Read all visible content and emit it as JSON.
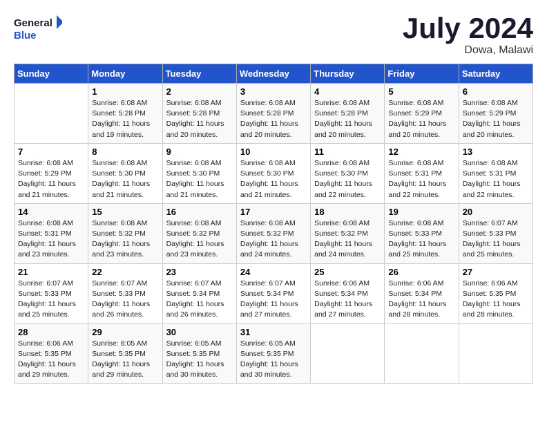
{
  "header": {
    "logo_line1": "General",
    "logo_line2": "Blue",
    "month_year": "July 2024",
    "location": "Dowa, Malawi"
  },
  "days_of_week": [
    "Sunday",
    "Monday",
    "Tuesday",
    "Wednesday",
    "Thursday",
    "Friday",
    "Saturday"
  ],
  "weeks": [
    [
      {
        "day": "",
        "sunrise": "",
        "sunset": "",
        "daylight": ""
      },
      {
        "day": "1",
        "sunrise": "Sunrise: 6:08 AM",
        "sunset": "Sunset: 5:28 PM",
        "daylight": "Daylight: 11 hours and 19 minutes."
      },
      {
        "day": "2",
        "sunrise": "Sunrise: 6:08 AM",
        "sunset": "Sunset: 5:28 PM",
        "daylight": "Daylight: 11 hours and 20 minutes."
      },
      {
        "day": "3",
        "sunrise": "Sunrise: 6:08 AM",
        "sunset": "Sunset: 5:28 PM",
        "daylight": "Daylight: 11 hours and 20 minutes."
      },
      {
        "day": "4",
        "sunrise": "Sunrise: 6:08 AM",
        "sunset": "Sunset: 5:28 PM",
        "daylight": "Daylight: 11 hours and 20 minutes."
      },
      {
        "day": "5",
        "sunrise": "Sunrise: 6:08 AM",
        "sunset": "Sunset: 5:29 PM",
        "daylight": "Daylight: 11 hours and 20 minutes."
      },
      {
        "day": "6",
        "sunrise": "Sunrise: 6:08 AM",
        "sunset": "Sunset: 5:29 PM",
        "daylight": "Daylight: 11 hours and 20 minutes."
      }
    ],
    [
      {
        "day": "7",
        "sunrise": "Sunrise: 6:08 AM",
        "sunset": "Sunset: 5:29 PM",
        "daylight": "Daylight: 11 hours and 21 minutes."
      },
      {
        "day": "8",
        "sunrise": "Sunrise: 6:08 AM",
        "sunset": "Sunset: 5:30 PM",
        "daylight": "Daylight: 11 hours and 21 minutes."
      },
      {
        "day": "9",
        "sunrise": "Sunrise: 6:08 AM",
        "sunset": "Sunset: 5:30 PM",
        "daylight": "Daylight: 11 hours and 21 minutes."
      },
      {
        "day": "10",
        "sunrise": "Sunrise: 6:08 AM",
        "sunset": "Sunset: 5:30 PM",
        "daylight": "Daylight: 11 hours and 21 minutes."
      },
      {
        "day": "11",
        "sunrise": "Sunrise: 6:08 AM",
        "sunset": "Sunset: 5:30 PM",
        "daylight": "Daylight: 11 hours and 22 minutes."
      },
      {
        "day": "12",
        "sunrise": "Sunrise: 6:08 AM",
        "sunset": "Sunset: 5:31 PM",
        "daylight": "Daylight: 11 hours and 22 minutes."
      },
      {
        "day": "13",
        "sunrise": "Sunrise: 6:08 AM",
        "sunset": "Sunset: 5:31 PM",
        "daylight": "Daylight: 11 hours and 22 minutes."
      }
    ],
    [
      {
        "day": "14",
        "sunrise": "Sunrise: 6:08 AM",
        "sunset": "Sunset: 5:31 PM",
        "daylight": "Daylight: 11 hours and 23 minutes."
      },
      {
        "day": "15",
        "sunrise": "Sunrise: 6:08 AM",
        "sunset": "Sunset: 5:32 PM",
        "daylight": "Daylight: 11 hours and 23 minutes."
      },
      {
        "day": "16",
        "sunrise": "Sunrise: 6:08 AM",
        "sunset": "Sunset: 5:32 PM",
        "daylight": "Daylight: 11 hours and 23 minutes."
      },
      {
        "day": "17",
        "sunrise": "Sunrise: 6:08 AM",
        "sunset": "Sunset: 5:32 PM",
        "daylight": "Daylight: 11 hours and 24 minutes."
      },
      {
        "day": "18",
        "sunrise": "Sunrise: 6:08 AM",
        "sunset": "Sunset: 5:32 PM",
        "daylight": "Daylight: 11 hours and 24 minutes."
      },
      {
        "day": "19",
        "sunrise": "Sunrise: 6:08 AM",
        "sunset": "Sunset: 5:33 PM",
        "daylight": "Daylight: 11 hours and 25 minutes."
      },
      {
        "day": "20",
        "sunrise": "Sunrise: 6:07 AM",
        "sunset": "Sunset: 5:33 PM",
        "daylight": "Daylight: 11 hours and 25 minutes."
      }
    ],
    [
      {
        "day": "21",
        "sunrise": "Sunrise: 6:07 AM",
        "sunset": "Sunset: 5:33 PM",
        "daylight": "Daylight: 11 hours and 25 minutes."
      },
      {
        "day": "22",
        "sunrise": "Sunrise: 6:07 AM",
        "sunset": "Sunset: 5:33 PM",
        "daylight": "Daylight: 11 hours and 26 minutes."
      },
      {
        "day": "23",
        "sunrise": "Sunrise: 6:07 AM",
        "sunset": "Sunset: 5:34 PM",
        "daylight": "Daylight: 11 hours and 26 minutes."
      },
      {
        "day": "24",
        "sunrise": "Sunrise: 6:07 AM",
        "sunset": "Sunset: 5:34 PM",
        "daylight": "Daylight: 11 hours and 27 minutes."
      },
      {
        "day": "25",
        "sunrise": "Sunrise: 6:06 AM",
        "sunset": "Sunset: 5:34 PM",
        "daylight": "Daylight: 11 hours and 27 minutes."
      },
      {
        "day": "26",
        "sunrise": "Sunrise: 6:06 AM",
        "sunset": "Sunset: 5:34 PM",
        "daylight": "Daylight: 11 hours and 28 minutes."
      },
      {
        "day": "27",
        "sunrise": "Sunrise: 6:06 AM",
        "sunset": "Sunset: 5:35 PM",
        "daylight": "Daylight: 11 hours and 28 minutes."
      }
    ],
    [
      {
        "day": "28",
        "sunrise": "Sunrise: 6:06 AM",
        "sunset": "Sunset: 5:35 PM",
        "daylight": "Daylight: 11 hours and 29 minutes."
      },
      {
        "day": "29",
        "sunrise": "Sunrise: 6:05 AM",
        "sunset": "Sunset: 5:35 PM",
        "daylight": "Daylight: 11 hours and 29 minutes."
      },
      {
        "day": "30",
        "sunrise": "Sunrise: 6:05 AM",
        "sunset": "Sunset: 5:35 PM",
        "daylight": "Daylight: 11 hours and 30 minutes."
      },
      {
        "day": "31",
        "sunrise": "Sunrise: 6:05 AM",
        "sunset": "Sunset: 5:35 PM",
        "daylight": "Daylight: 11 hours and 30 minutes."
      },
      {
        "day": "",
        "sunrise": "",
        "sunset": "",
        "daylight": ""
      },
      {
        "day": "",
        "sunrise": "",
        "sunset": "",
        "daylight": ""
      },
      {
        "day": "",
        "sunrise": "",
        "sunset": "",
        "daylight": ""
      }
    ]
  ]
}
